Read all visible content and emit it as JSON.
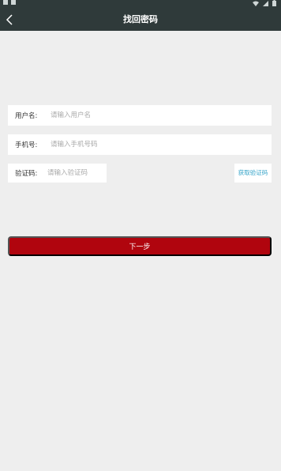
{
  "status_bar": {
    "icons": [
      "notification-icon",
      "image-icon",
      "wifi-icon",
      "signal-icon",
      "battery-icon"
    ]
  },
  "header": {
    "title": "找回密码",
    "back_icon": "back-arrow-icon",
    "background": "#2f3a3a"
  },
  "form": {
    "username": {
      "label": "用户名:",
      "placeholder": "请输入用户名"
    },
    "phone": {
      "label": "手机号:",
      "placeholder": "请输入手机号码"
    },
    "code": {
      "label": "验证码:",
      "placeholder": "请输入验证码"
    },
    "get_code_label": "获取验证码",
    "get_code_color": "#34a3c8"
  },
  "next_button": {
    "label": "下一步",
    "color": "#b0050e"
  }
}
